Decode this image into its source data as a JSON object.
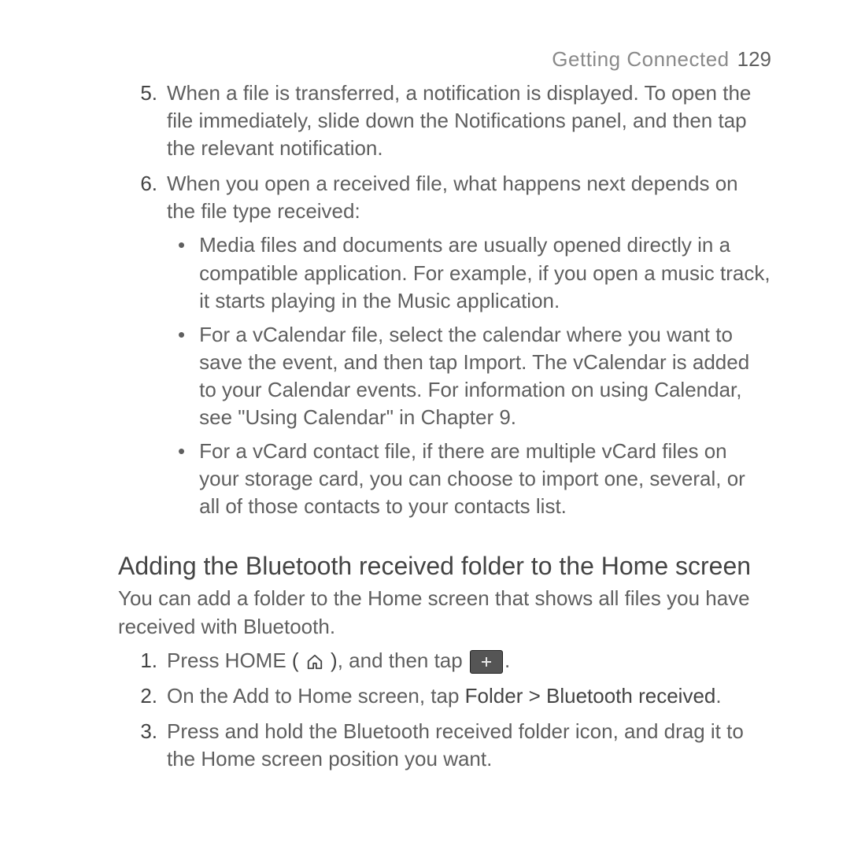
{
  "header": {
    "title": "Getting Connected",
    "page": "129"
  },
  "list5": {
    "num": "5.",
    "text": "When a file is transferred, a notification is displayed. To open the file immediately, slide down the Notifications panel, and then tap the relevant notification."
  },
  "list6": {
    "num": "6.",
    "text": "When you open a received file, what happens next depends on the file type received:",
    "bullets": [
      "Media files and documents are usually opened directly in a compatible application. For example, if you open a music track, it starts playing in the Music application.",
      "For a vCalendar file, select the calendar where you want to save the event, and then tap Import. The vCalendar is added to your Calendar events. For information on using Calendar, see \"Using Calendar\" in Chapter 9.",
      "For a vCard contact file, if there are multiple vCard files on your storage card, you can choose to import one, several, or all of those contacts to your contacts list."
    ]
  },
  "section": {
    "heading": "Adding the Bluetooth received folder to the Home screen",
    "intro": "You can add a folder to the Home screen that shows all files you have received with Bluetooth."
  },
  "steps": {
    "s1": {
      "num": "1.",
      "before": "Press HOME ",
      "open": "( ",
      "close": " )",
      "after": ", and then tap ",
      "tail": "."
    },
    "s2": {
      "num": "2.",
      "before": "On the Add to Home screen, tap ",
      "strong": "Folder > Bluetooth received",
      "tail": "."
    },
    "s3": {
      "num": "3.",
      "text": "Press and hold the Bluetooth received folder icon, and drag it to the Home screen position you want."
    }
  }
}
